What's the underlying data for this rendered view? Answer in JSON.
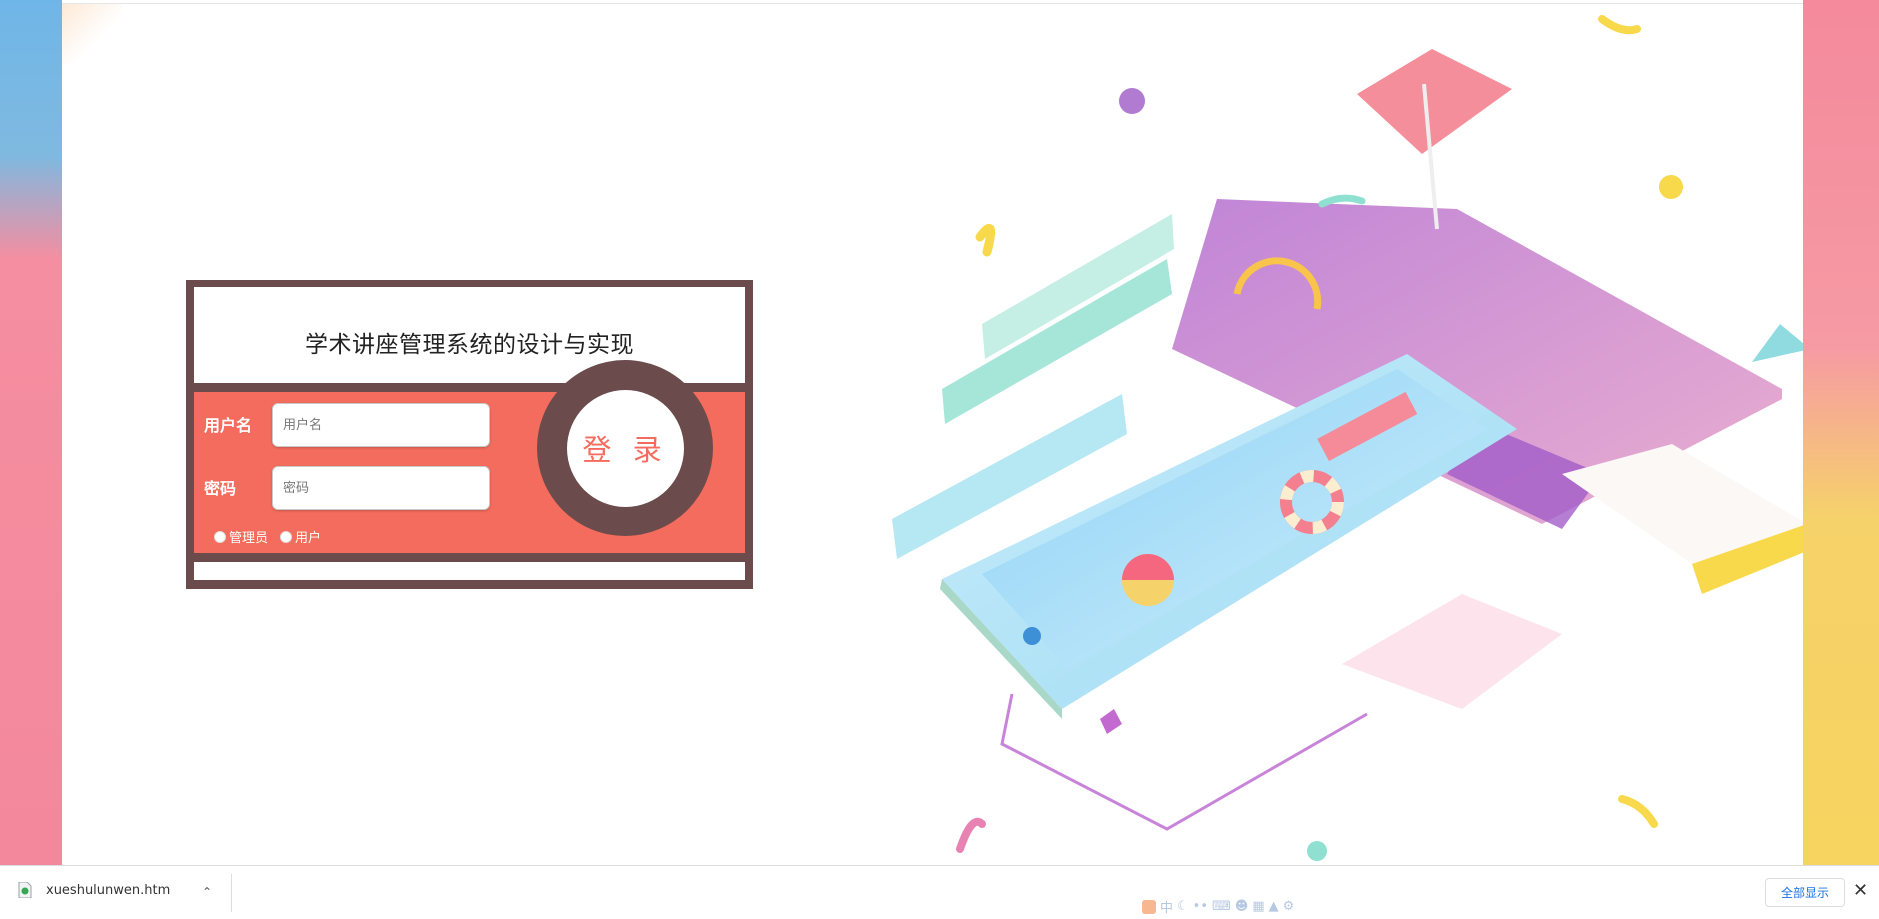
{
  "login": {
    "title": "学术讲座管理系统的设计与实现",
    "username_label": "用户名",
    "username_placeholder": "用户名",
    "password_label": "密码",
    "password_placeholder": "密码",
    "roles": [
      "管理员",
      "用户"
    ],
    "login_button": "登 录"
  },
  "download_bar": {
    "filename": "xueshulunwen.htm",
    "show_all": "全部显示"
  },
  "ime": {
    "label": "中"
  },
  "colors": {
    "card_frame": "#6b4b4b",
    "form_bg": "#f46c5d",
    "accent_text": "#f46c5d"
  },
  "icons": [
    "chevron-up-icon",
    "close-icon",
    "file-icon",
    "cursor-icon"
  ]
}
